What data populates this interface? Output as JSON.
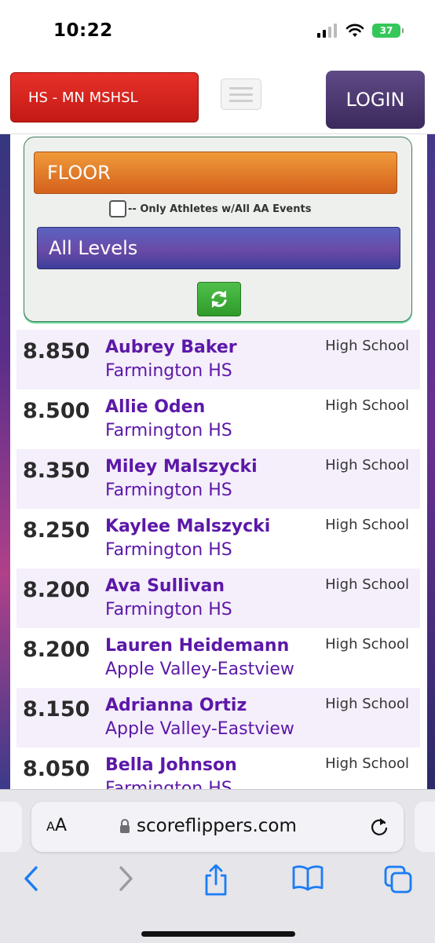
{
  "status_bar": {
    "time": "10:22",
    "battery": "37"
  },
  "header": {
    "league_label": "HS - MN MSHSL",
    "login_label": "LOGIN"
  },
  "filters": {
    "event": "FLOOR",
    "aa_only_label": "-- Only Athletes w/All AA Events",
    "level": "All Levels"
  },
  "results": [
    {
      "score": "8.850",
      "name": "Aubrey Baker",
      "team": "Farmington HS",
      "level": "High School"
    },
    {
      "score": "8.500",
      "name": "Allie Oden",
      "team": "Farmington HS",
      "level": "High School"
    },
    {
      "score": "8.350",
      "name": "Miley Malszycki",
      "team": "Farmington HS",
      "level": "High School"
    },
    {
      "score": "8.250",
      "name": "Kaylee Malszycki",
      "team": "Farmington HS",
      "level": "High School"
    },
    {
      "score": "8.200",
      "name": "Ava Sullivan",
      "team": "Farmington HS",
      "level": "High School"
    },
    {
      "score": "8.200",
      "name": "Lauren Heidemann",
      "team": "Apple Valley-Eastview",
      "level": "High School"
    },
    {
      "score": "8.150",
      "name": "Adrianna Ortiz",
      "team": "Apple Valley-Eastview",
      "level": "High School"
    },
    {
      "score": "8.050",
      "name": "Bella Johnson",
      "team": "Farmington HS",
      "level": "High School"
    }
  ],
  "browser": {
    "aa_small": "A",
    "aa_big": "A",
    "url": "scoreflippers.com"
  },
  "colors": {
    "accent_purple": "#5c18a8",
    "league_red": "#d42018",
    "event_orange": "#e07a2a",
    "level_purple": "#5a4ab0",
    "refresh_green": "#3aa835"
  }
}
